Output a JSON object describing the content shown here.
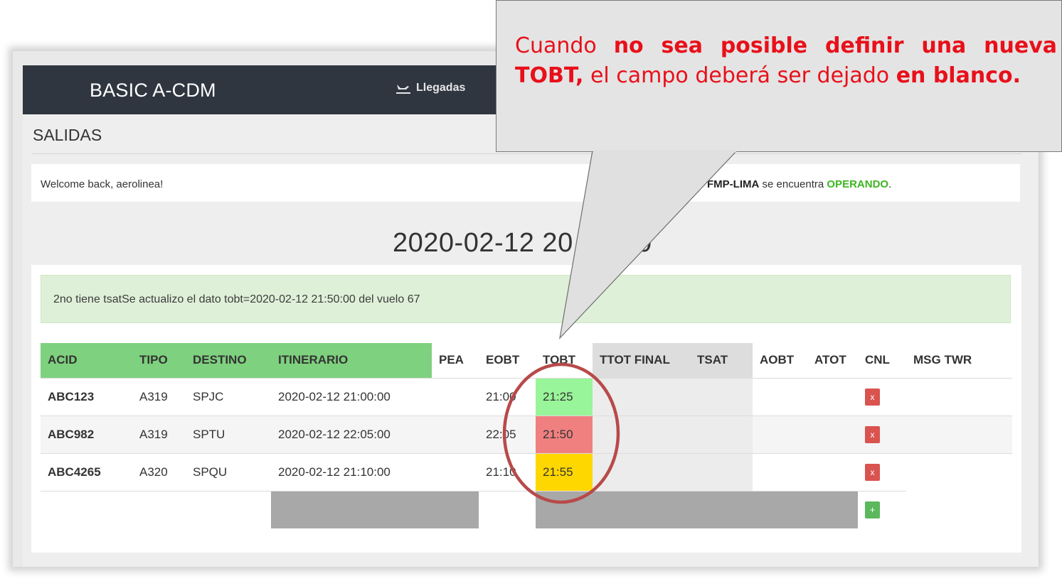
{
  "navbar": {
    "brand": "BASIC A-CDM",
    "llegadas_label": "Llegadas"
  },
  "page": {
    "heading": "SALIDAS",
    "welcome": "Welcome back, aerolinea!",
    "status_prefix": "FMP-LIMA",
    "status_middle": " se encuentra ",
    "status_value": "OPERANDO",
    "status_suffix": ".",
    "datetime": "2020-02-12 20",
    "datetime_tail": "0"
  },
  "alert": {
    "text": "2no tiene tsatSe actualizo el dato tobt=2020-02-12 21:50:00 del vuelo 67"
  },
  "table": {
    "headers": [
      "ACID",
      "TIPO",
      "DESTINO",
      "ITINERARIO",
      "PEA",
      "EOBT",
      "TOBT",
      "TTOT FINAL",
      "TSAT",
      "AOBT",
      "ATOT",
      "CNL",
      "MSG TWR"
    ],
    "rows": [
      {
        "acid": "ABC123",
        "tipo": "A319",
        "destino": "SPJC",
        "itinerario": "2020-02-12 21:00:00",
        "pea": "",
        "eobt": "21:00",
        "tobt": "21:25",
        "tobt_status": "green",
        "cnl": "x"
      },
      {
        "acid": "ABC982",
        "tipo": "A319",
        "destino": "SPTU",
        "itinerario": "2020-02-12 22:05:00",
        "pea": "",
        "eobt": "22:05",
        "tobt": "21:50",
        "tobt_status": "red",
        "cnl": "x"
      },
      {
        "acid": "ABC4265",
        "tipo": "A320",
        "destino": "SPQU",
        "itinerario": "2020-02-12 21:10:00",
        "pea": "",
        "eobt": "21:10",
        "tobt": "21:55",
        "tobt_status": "yellow",
        "cnl": "x"
      }
    ],
    "add_button": "+"
  },
  "callout": {
    "part1": "Cuando ",
    "part2": "no sea posible definir una nueva TOBT,",
    "part3": " el campo deberá ser dejado ",
    "part4": "en blanco."
  },
  "colors": {
    "navbar": "#2f3640",
    "header_green": "#7ed17e",
    "tobt_green": "#99f599",
    "tobt_red": "#f08080",
    "tobt_yellow": "#ffd700",
    "status_ok": "#3cb521",
    "callout_text": "#e8101a",
    "circle": "#b84a4a"
  }
}
